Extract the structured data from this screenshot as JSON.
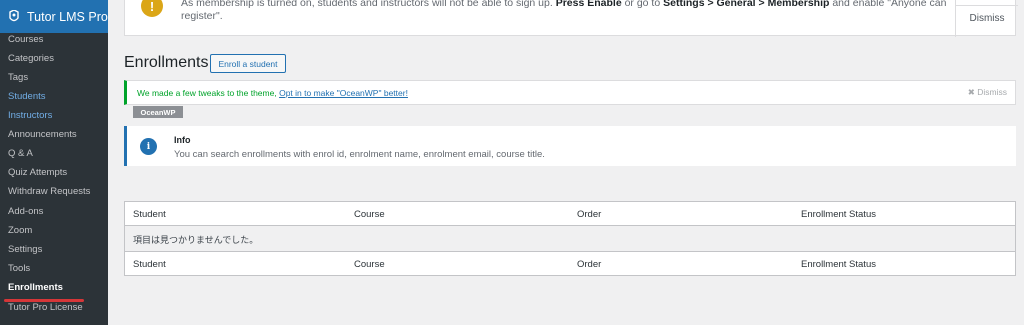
{
  "sidebar": {
    "plugin_title": "Tutor LMS Pro",
    "items": [
      {
        "label": "Courses"
      },
      {
        "label": "Categories"
      },
      {
        "label": "Tags"
      },
      {
        "label": "Students"
      },
      {
        "label": "Instructors"
      },
      {
        "label": "Announcements"
      },
      {
        "label": "Q & A"
      },
      {
        "label": "Quiz Attempts"
      },
      {
        "label": "Withdraw Requests"
      },
      {
        "label": "Add-ons"
      },
      {
        "label": "Zoom"
      },
      {
        "label": "Settings"
      },
      {
        "label": "Tools"
      },
      {
        "label": "Enrollments"
      },
      {
        "label": "Tutor Pro License"
      }
    ]
  },
  "membership_notice": {
    "line1_start": "As membership is turned on, students and instructors will not be able to sign up.",
    "enable": "Press Enable",
    "middle": "or go to",
    "path": "Settings > General > Membership",
    "end": "and enable \"Anyone can",
    "line2": "register\".",
    "dismiss": "Dismiss"
  },
  "page": {
    "title": "Enrollments",
    "enroll_button": "Enroll a student"
  },
  "ocean_notice": {
    "message": "We made a few tweaks to the theme,",
    "link": "Opt in to make \"OceanWP\" better!",
    "dismiss": "Dismiss",
    "tag": "OceanWP"
  },
  "info": {
    "icon": "i",
    "title": "Info",
    "description": "You can search enrollments with enrol id, enrolment name, enrolment email, course title."
  },
  "table": {
    "columns": [
      "Student",
      "Course",
      "Order",
      "Enrollment Status"
    ],
    "empty_message": "項目は見つかりませんでした。"
  },
  "colors": {
    "accent": "#2271b1",
    "sidebar_bg": "#1d2327",
    "notice_green": "#00a32a",
    "underline_red": "#d63638"
  }
}
